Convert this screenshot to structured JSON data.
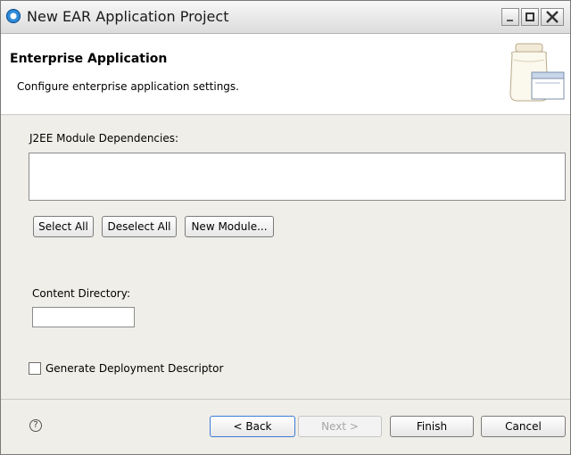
{
  "window": {
    "title": "New EAR Application Project",
    "app_icon": "eclipse-icon",
    "controls": {
      "minimize": "minimize-icon",
      "maximize": "maximize-icon",
      "close": "close-icon"
    }
  },
  "banner": {
    "title": "Enterprise Application",
    "subtitle": "Configure enterprise application settings.",
    "icon": "jar-window-icon"
  },
  "form": {
    "module_deps_label": "J2EE Module Dependencies:",
    "module_deps_items": [],
    "buttons": {
      "select_all": "Select All",
      "deselect_all": "Deselect All",
      "new_module": "New Module..."
    },
    "content_dir_label": "Content Directory:",
    "content_dir_value": "",
    "generate_dd_label": "Generate Deployment Descriptor",
    "generate_dd_checked": false
  },
  "footer": {
    "help_icon": "help-icon",
    "back": "< Back",
    "next": "Next >",
    "finish": "Finish",
    "cancel": "Cancel"
  },
  "colors": {
    "dialog_bg": "#f0eee8",
    "banner_bg": "#ffffff",
    "default_button_border": "#3d7bd8",
    "disabled_text": "#a5a5a5"
  }
}
